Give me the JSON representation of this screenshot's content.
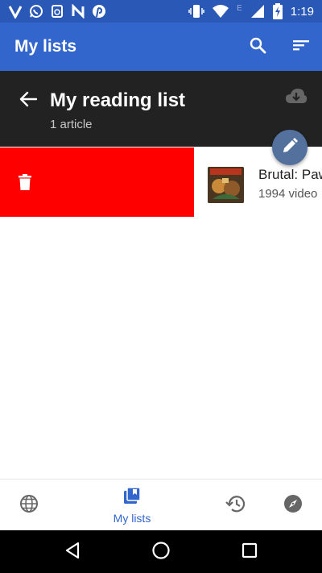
{
  "status_bar": {
    "time": "1:19",
    "left_icons": [
      "v-app-icon",
      "whatsapp-icon",
      "sync-icon",
      "n-app-icon",
      "pinterest-icon"
    ],
    "right_icons": [
      "vibrate-icon",
      "wifi-icon",
      "signal-icon",
      "battery-charging-icon"
    ],
    "network_label": "E"
  },
  "app_bar": {
    "title": "My lists",
    "actions": [
      "search-icon",
      "sort-icon"
    ]
  },
  "list_header": {
    "title": "My reading list",
    "count": "1 article"
  },
  "articles": [
    {
      "title": "Brutal: Paws of Fury",
      "title_visible": "Brutal: Paw",
      "description_visible": "1994 video",
      "thumbnail": "game-cover-thumbnail"
    }
  ],
  "bottom_nav": {
    "items": [
      {
        "name": "explore",
        "icon": "globe-icon",
        "label": ""
      },
      {
        "name": "my-lists",
        "icon": "reading-lists-icon",
        "label": "My lists",
        "active": true
      },
      {
        "name": "history",
        "icon": "history-icon",
        "label": ""
      },
      {
        "name": "nearby",
        "icon": "compass-icon",
        "label": ""
      }
    ]
  },
  "colors": {
    "status_bar": "#2a58b6",
    "app_bar": "#3366cc",
    "header_bg": "#222222",
    "delete_bg": "#ff0000",
    "fab": "#54709c",
    "active_nav": "#3366cc"
  }
}
